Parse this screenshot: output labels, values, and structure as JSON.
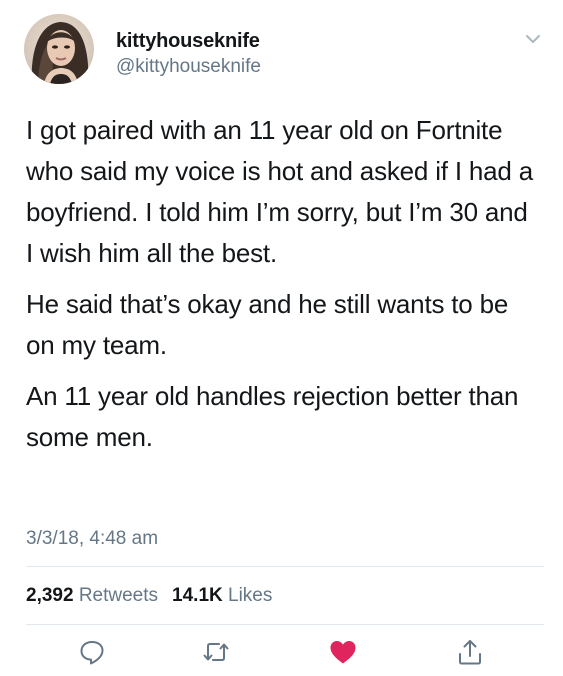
{
  "author": {
    "display_name": "kittyhouseknife",
    "handle": "@kittyhouseknife"
  },
  "tweet": {
    "paragraphs": [
      "I got paired with an 11 year old on Fortnite who said my voice is hot and asked if I had a boyfriend. I told him I’m sorry, but I’m 30 and I wish him all the best.",
      "He said that’s okay and he still wants to be on my team.",
      "An 11 year old handles rejection better than some men."
    ],
    "timestamp": "3/3/18, 4:48 am"
  },
  "stats": {
    "retweets_count": "2,392",
    "retweets_label": "Retweets",
    "likes_count": "14.1K",
    "likes_label": "Likes"
  },
  "icons": {
    "menu": "chevron-down-icon",
    "reply": "reply-icon",
    "retweet": "retweet-icon",
    "like": "heart-icon",
    "share": "share-icon"
  },
  "colors": {
    "text": "#14171a",
    "secondary": "#657786",
    "divider": "#e1e8ed",
    "like": "#e0245e"
  }
}
